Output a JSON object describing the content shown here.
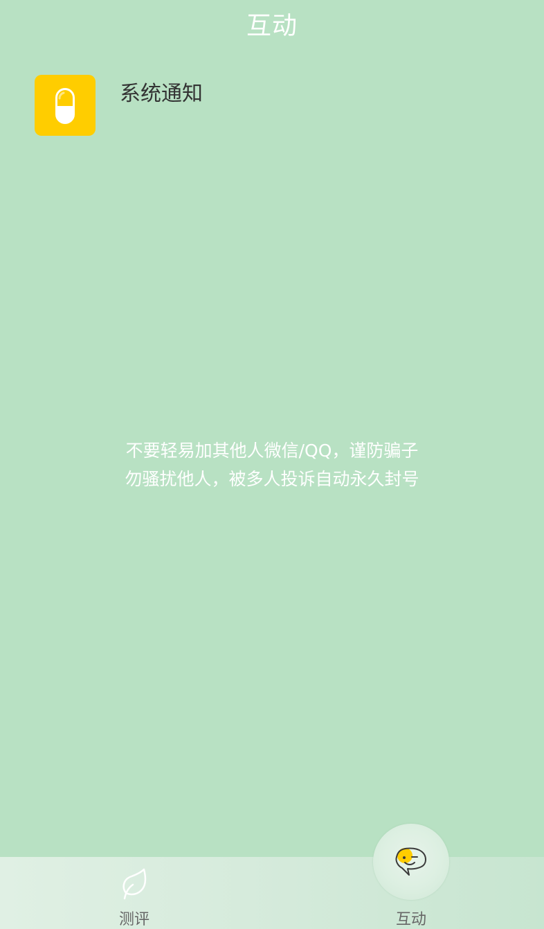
{
  "header": {
    "title": "互动"
  },
  "notice": {
    "title": "系统通知",
    "icon": "capsule-icon",
    "icon_color": "#ffcd00"
  },
  "tips": {
    "line1": "不要轻易加其他人微信/QQ，谨防骗子",
    "line2": "勿骚扰他人，被多人投诉自动永久封号"
  },
  "tabbar": {
    "tabs": [
      {
        "label": "测评",
        "icon": "leaf-icon"
      },
      {
        "label": "互动",
        "icon": "chat-face-icon",
        "selected": true
      }
    ]
  },
  "colors": {
    "background": "#b8e1c3",
    "accent": "#ffcd00"
  }
}
